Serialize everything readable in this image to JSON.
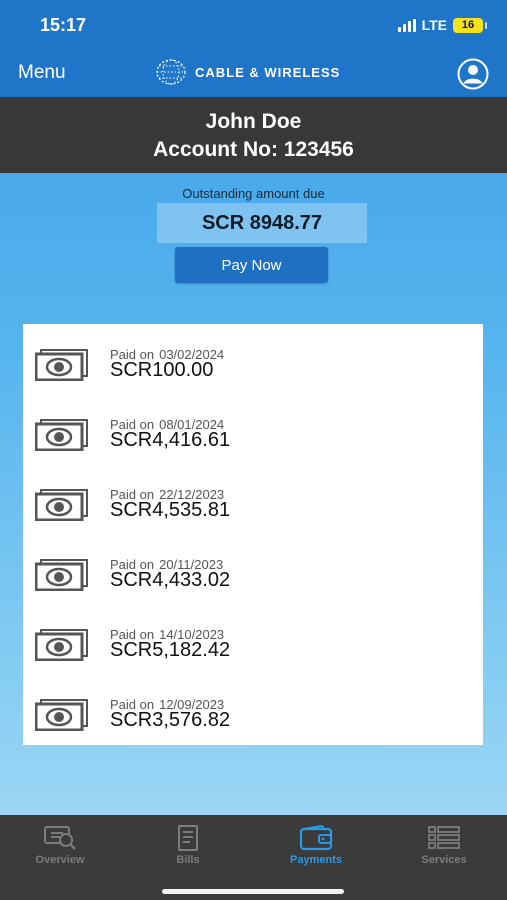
{
  "status_bar": {
    "time": "15:17",
    "network": "LTE",
    "battery": "16"
  },
  "header": {
    "menu_label": "Menu",
    "brand": "CABLE & WIRELESS",
    "profile_icon": "user-circle-icon"
  },
  "account": {
    "name": "John Doe",
    "number_label": "Account No: 123456"
  },
  "outstanding": {
    "label": "Outstanding amount due",
    "amount": "SCR 8948.77"
  },
  "pay_button": {
    "label": "Pay Now"
  },
  "payments": [
    {
      "paid_label": "Paid on",
      "date": "03/02/2024",
      "amount": "SCR100.00"
    },
    {
      "paid_label": "Paid on",
      "date": "08/01/2024",
      "amount": "SCR4,416.61"
    },
    {
      "paid_label": "Paid on",
      "date": "22/12/2023",
      "amount": "SCR4,535.81"
    },
    {
      "paid_label": "Paid on",
      "date": "20/11/2023",
      "amount": "SCR4,433.02"
    },
    {
      "paid_label": "Paid on",
      "date": "14/10/2023",
      "amount": "SCR5,182.42"
    },
    {
      "paid_label": "Paid on",
      "date": "12/09/2023",
      "amount": "SCR3,576.82"
    }
  ],
  "tabs": [
    {
      "label": "Overview",
      "icon": "overview-icon",
      "active": false
    },
    {
      "label": "Bills",
      "icon": "bills-icon",
      "active": false
    },
    {
      "label": "Payments",
      "icon": "wallet-icon",
      "active": true
    },
    {
      "label": "Services",
      "icon": "services-icon",
      "active": false
    }
  ],
  "colors": {
    "header_blue": "#1f76c9",
    "account_bar": "#383838",
    "active_tab": "#2a9ae8",
    "pay_button": "#1f6fc2"
  }
}
